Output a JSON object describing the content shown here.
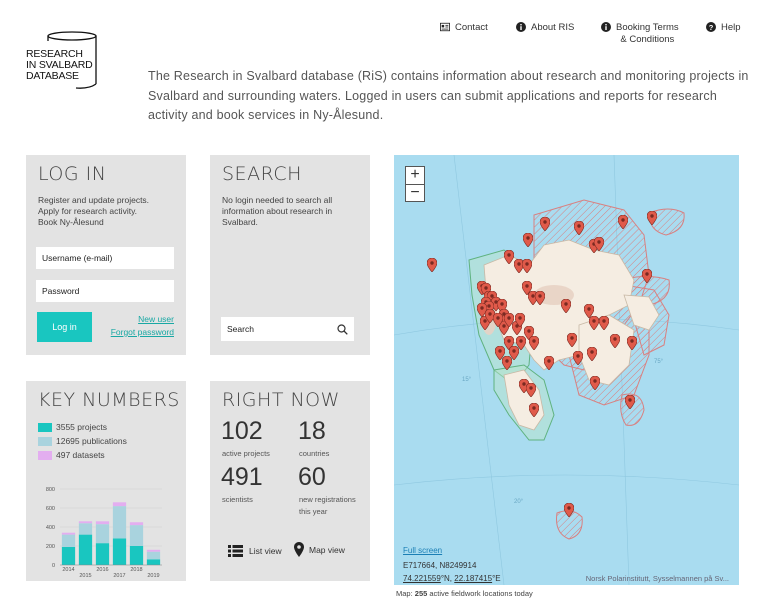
{
  "logo": {
    "lines": [
      "RESEARCH",
      "IN SVALBARD",
      "DATABASE"
    ]
  },
  "nav": [
    {
      "label": "Contact",
      "icon": "contact-card-icon"
    },
    {
      "label": "About RIS",
      "icon": "info-icon"
    },
    {
      "label": "Booking Terms & Conditions",
      "line1": "Booking Terms",
      "line2": "& Conditions",
      "icon": "info-icon"
    },
    {
      "label": "Help",
      "icon": "help-icon"
    }
  ],
  "intro": "The Research in Svalbard database (RiS) contains information about research and monitoring projects in Svalbard and surrounding waters. Logged in users can submit applications and reports for research activity and book services in Ny-Ålesund.",
  "login": {
    "title": "LOG IN",
    "desc1": "Register and update projects.",
    "desc2": "Apply for research activity.",
    "desc3": "Book Ny-Ålesund",
    "username_placeholder": "Username (e-mail)",
    "password_placeholder": "Password",
    "button": "Log in",
    "new_user": "New user",
    "forgot": "Forgot password"
  },
  "search": {
    "title": "SEARCH",
    "desc1": "No login needed to search all",
    "desc2": "information about research in",
    "desc3": "Svalbard.",
    "placeholder": "Search"
  },
  "key_numbers": {
    "title": "KEY NUMBERS",
    "legend": [
      {
        "text": "3555 projects",
        "color": "#19c6c0"
      },
      {
        "text": "12695 publications",
        "color": "#a9d3de"
      },
      {
        "text": "497 datasets",
        "color": "#e3aef0"
      }
    ]
  },
  "chart_data": {
    "type": "bar",
    "stacked": true,
    "categories": [
      "2014",
      "2015",
      "2016",
      "2017",
      "2018",
      "2019"
    ],
    "series": [
      {
        "name": "projects",
        "values": [
          190,
          320,
          230,
          280,
          200,
          60
        ]
      },
      {
        "name": "publications",
        "values": [
          130,
          120,
          200,
          340,
          220,
          80
        ]
      },
      {
        "name": "datasets",
        "values": [
          20,
          20,
          30,
          40,
          30,
          20
        ]
      }
    ],
    "ylim": [
      0,
      800
    ],
    "yticks": [
      0,
      200,
      400,
      600,
      800
    ]
  },
  "right_now": {
    "title": "RIGHT NOW",
    "projects": "102",
    "projects_label": "active projects",
    "countries": "18",
    "countries_label": "countries",
    "scientists": "491",
    "scientists_label": "scientists",
    "registrations": "60",
    "registrations_label1": "new registrations",
    "registrations_label2": "this year",
    "list_view": "List view",
    "map_view": "Map view"
  },
  "map": {
    "zoom_in": "+",
    "zoom_out": "−",
    "full_screen": "Full screen",
    "coords": "E717664, N8249914",
    "lat": "74.221559",
    "lat_suffix": "°N,",
    "lon": "22.187415",
    "lon_suffix": "°E",
    "attribution": "Norsk Polarinstitutt, Sysselmannen på Sv...",
    "caption_prefix": "Map:",
    "caption_count": "255",
    "caption_suffix": "active fieldwork locations today",
    "grid_labels": [
      "75°",
      "15°",
      "20°"
    ]
  },
  "colors": {
    "accent": "#19c6c0",
    "panel": "#e3e3e3",
    "pin": "#e05a4a",
    "sea": "#a9dcf0"
  }
}
